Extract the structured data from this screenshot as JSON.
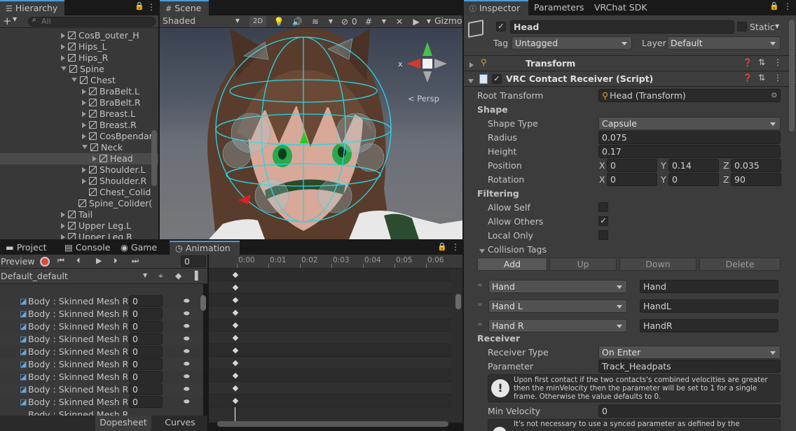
{
  "hierarchy": {
    "tab": "Hierarchy",
    "search_placeholder": "All",
    "rows": [
      {
        "label": "CosB_outer_H",
        "indent": 5,
        "arrow": "right",
        "selected": false
      },
      {
        "label": "Hips_L",
        "indent": 5,
        "arrow": "right",
        "selected": false
      },
      {
        "label": "Hips_R",
        "indent": 5,
        "arrow": "right",
        "selected": false
      },
      {
        "label": "Spine",
        "indent": 5,
        "arrow": "down",
        "selected": false
      },
      {
        "label": "Chest",
        "indent": 6,
        "arrow": "down",
        "selected": false
      },
      {
        "label": "BraBelt.L",
        "indent": 7,
        "arrow": "right",
        "selected": false
      },
      {
        "label": "BraBelt.R",
        "indent": 7,
        "arrow": "right",
        "selected": false
      },
      {
        "label": "Breast.L",
        "indent": 7,
        "arrow": "right",
        "selected": false
      },
      {
        "label": "Breast.R",
        "indent": 7,
        "arrow": "right",
        "selected": false
      },
      {
        "label": "CosBpendar",
        "indent": 7,
        "arrow": "right",
        "selected": false
      },
      {
        "label": "Neck",
        "indent": 7,
        "arrow": "down",
        "selected": false
      },
      {
        "label": "Head",
        "indent": 8,
        "arrow": "right",
        "selected": true
      },
      {
        "label": "Shoulder.L",
        "indent": 7,
        "arrow": "right",
        "selected": false
      },
      {
        "label": "Shoulder.R",
        "indent": 7,
        "arrow": "right",
        "selected": false
      },
      {
        "label": "Chest_Colid",
        "indent": 7,
        "arrow": "none",
        "selected": false
      },
      {
        "label": "Spine_Colider(",
        "indent": 6,
        "arrow": "none",
        "selected": false
      },
      {
        "label": "Tail",
        "indent": 5,
        "arrow": "right",
        "selected": false
      },
      {
        "label": "Upper Leg.L",
        "indent": 5,
        "arrow": "right",
        "selected": false
      },
      {
        "label": "Upper Leg.R",
        "indent": 5,
        "arrow": "right",
        "selected": false
      }
    ]
  },
  "scene": {
    "tab": "Scene",
    "shading": "Shaded",
    "mode_2d": "2D",
    "hidden_count": "0",
    "gizmos": "Gizmos",
    "persp_label": "< Persp",
    "axis_x": "x"
  },
  "inspector": {
    "tabs": [
      "Inspector",
      "Parameters",
      "VRChat SDK"
    ],
    "object_name": "Head",
    "static_label": "Static",
    "tag_label": "Tag",
    "tag_value": "Untagged",
    "layer_label": "Layer",
    "layer_value": "Default",
    "transform_title": "Transform",
    "component_title": "VRC Contact Receiver (Script)",
    "root_transform_label": "Root Transform",
    "root_transform_value": "Head (Transform)",
    "shape_header": "Shape",
    "shape_type_label": "Shape Type",
    "shape_type_value": "Capsule",
    "radius_label": "Radius",
    "radius_value": "0.075",
    "height_label": "Height",
    "height_value": "0.17",
    "position_label": "Position",
    "position": {
      "x": "0",
      "y": "0.14",
      "z": "0.035"
    },
    "rotation_label": "Rotation",
    "rotation": {
      "x": "0",
      "y": "0",
      "z": "90"
    },
    "axis_labels": {
      "x": "X",
      "y": "Y",
      "z": "Z"
    },
    "filtering_header": "Filtering",
    "allow_self_label": "Allow Self",
    "allow_self": false,
    "allow_others_label": "Allow Others",
    "allow_others": true,
    "local_only_label": "Local Only",
    "local_only": false,
    "collision_tags_label": "Collision Tags",
    "buttons": {
      "add": "Add",
      "up": "Up",
      "down": "Down",
      "delete": "Delete"
    },
    "collision_tags": [
      {
        "type": "Hand",
        "value": "Hand"
      },
      {
        "type": "Hand L",
        "value": "HandL"
      },
      {
        "type": "Hand R",
        "value": "HandR"
      }
    ],
    "receiver_header": "Receiver",
    "receiver_type_label": "Receiver Type",
    "receiver_type_value": "On Enter",
    "parameter_label": "Parameter",
    "parameter_value": "Track_Headpats",
    "info_text": "Upon first contact if the two contacts's combined velocities are greater then the minVelocity then the parameter will be set to 1 for a single frame. Otherwise the value defaults to 0.",
    "min_velocity_label": "Min Velocity",
    "min_velocity_value": "0",
    "bottom_note": "It's not necessary to use a synced parameter as defined by the"
  },
  "animation": {
    "tabs": [
      "Project",
      "Console",
      "Game",
      "Animation"
    ],
    "preview_label": "Preview",
    "frame_value": "0",
    "clip_name": "Default_default",
    "time_ticks": [
      "0:00",
      "0:01",
      "0:02",
      "0:03",
      "0:04",
      "0:05",
      "0:06"
    ],
    "property_label": "Body : Skinned Mesh Rer",
    "property_rows": [
      "0",
      "0",
      "0",
      "0",
      "0",
      "0",
      "0",
      "0",
      "0"
    ],
    "last_row_label": "Body : Skinned Mesh Rer",
    "bottom_tabs": [
      "Dopesheet",
      "Curves"
    ]
  }
}
